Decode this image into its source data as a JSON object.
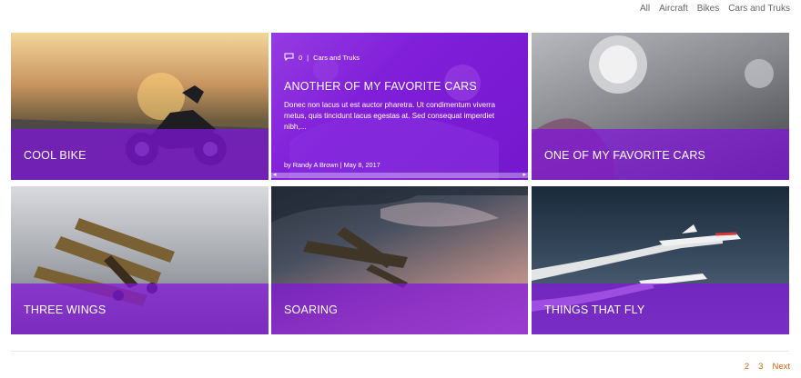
{
  "filters": [
    "All",
    "Aircraft",
    "Bikes",
    "Cars and Truks"
  ],
  "cards": [
    {
      "title": "COOL BIKE"
    },
    {
      "title": "ANOTHER OF MY FAVORITE CARS",
      "comment_count": "0",
      "category": "Cars and Truks",
      "excerpt": "Donec non lacus ut est auctor pharetra. Ut condimentum viverra metus, quis tincidunt lacus egestas at. Sed consequat imperdiet nibh,...",
      "byline": "by Randy A Brown  |  May 8, 2017"
    },
    {
      "title": "ONE OF MY FAVORITE CARS"
    },
    {
      "title": "THREE WINGS"
    },
    {
      "title": "SOARING"
    },
    {
      "title": "THINGS THAT FLY"
    }
  ],
  "pagination": {
    "page2": "2",
    "page3": "3",
    "next": "Next"
  },
  "icons": {
    "comment": "comment-icon"
  }
}
